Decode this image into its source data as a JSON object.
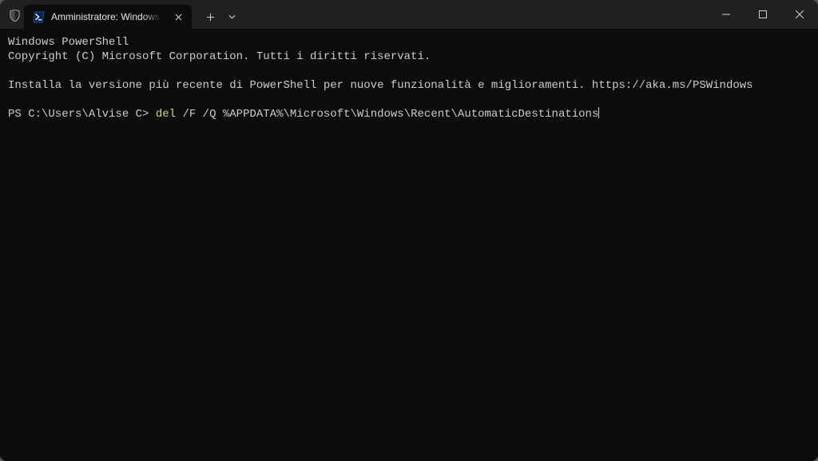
{
  "tab": {
    "title": "Amministratore: Windows PowerShell"
  },
  "window_controls": {
    "minimize": "Minimize",
    "maximize": "Maximize",
    "close": "Close"
  },
  "terminal": {
    "line1": "Windows PowerShell",
    "line2": "Copyright (C) Microsoft Corporation. Tutti i diritti riservati.",
    "line3": "",
    "line4": "Installa la versione più recente di PowerShell per nuove funzionalità e miglioramenti. https://aka.ms/PSWindows",
    "line5": "",
    "prompt": "PS C:\\Users\\Alvise C> ",
    "cmd_keyword": "del",
    "cmd_rest": " /F /Q %APPDATA%\\Microsoft\\Windows\\Recent\\AutomaticDestinations"
  }
}
